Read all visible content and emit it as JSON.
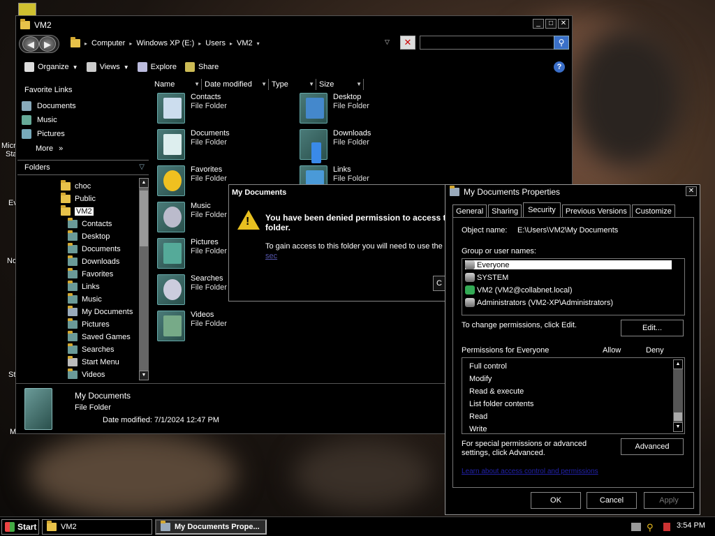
{
  "desktop": {
    "labels": [
      "Micro",
      "Sta",
      "Ev",
      "No",
      "St",
      "M"
    ]
  },
  "explorer": {
    "title": "VM2",
    "nav": {
      "back": "◀",
      "forward": "▶"
    },
    "breadcrumb": [
      "Computer",
      "Windows XP (E:)",
      "Users",
      "VM2"
    ],
    "search_placeholder": "",
    "toolbar": {
      "organize": "Organize",
      "views": "Views",
      "explore": "Explore",
      "share": "Share"
    },
    "favorites_title": "Favorite Links",
    "favorites": [
      "Documents",
      "Music",
      "Pictures"
    ],
    "more": "More",
    "folders_title": "Folders",
    "tree": [
      "choc",
      "Public",
      "VM2",
      "Contacts",
      "Desktop",
      "Documents",
      "Downloads",
      "Favorites",
      "Links",
      "Music",
      "My Documents",
      "Pictures",
      "Saved Games",
      "Searches",
      "Start Menu",
      "Videos"
    ],
    "columns": [
      "Name",
      "Date modified",
      "Type",
      "Size"
    ],
    "files": [
      {
        "name": "Contacts",
        "type": "File Folder"
      },
      {
        "name": "Desktop",
        "type": "File Folder"
      },
      {
        "name": "Documents",
        "type": "File Folder"
      },
      {
        "name": "Downloads",
        "type": "File Folder"
      },
      {
        "name": "Favorites",
        "type": "File Folder"
      },
      {
        "name": "Links",
        "type": "File Folder"
      },
      {
        "name": "Music",
        "type": "File Folder"
      },
      {
        "name": "Pictures",
        "type": "File Folder"
      },
      {
        "name": "Searches",
        "type": "File Folder"
      },
      {
        "name": "Videos",
        "type": "File Folder"
      }
    ],
    "details": {
      "name": "My Documents",
      "type": "File Folder",
      "date_label": "Date modified:",
      "date": "7/1/2024 12:47 PM"
    }
  },
  "error_dialog": {
    "title": "My Documents",
    "main": "You have been denied permission to access th folder.",
    "sub": "To gain access to this folder you will need to use the",
    "link": "sec",
    "button": "C"
  },
  "properties": {
    "title": "My Documents Properties",
    "tabs": [
      "General",
      "Sharing",
      "Security",
      "Previous Versions",
      "Customize"
    ],
    "object_name_label": "Object name:",
    "object_name": "E:\\Users\\VM2\\My Documents",
    "group_label": "Group or user names:",
    "users": [
      "Everyone",
      "SYSTEM",
      "VM2 (VM2@collabnet.local)",
      "Administrators (VM2-XP\\Administrators)"
    ],
    "change_text": "To change permissions, click Edit.",
    "edit_button": "Edit...",
    "perms_label": "Permissions for Everyone",
    "allow": "Allow",
    "deny": "Deny",
    "permissions": [
      "Full control",
      "Modify",
      "Read & execute",
      "List folder contents",
      "Read",
      "Write"
    ],
    "special_text": "For special permissions or advanced settings, click Advanced.",
    "advanced_button": "Advanced",
    "learn_link": "Learn about access control and permissions",
    "ok": "OK",
    "cancel": "Cancel",
    "apply": "Apply"
  },
  "taskbar": {
    "start": "Start",
    "tasks": [
      "VM2",
      "My Documents Prope..."
    ],
    "clock": "3:54 PM"
  }
}
